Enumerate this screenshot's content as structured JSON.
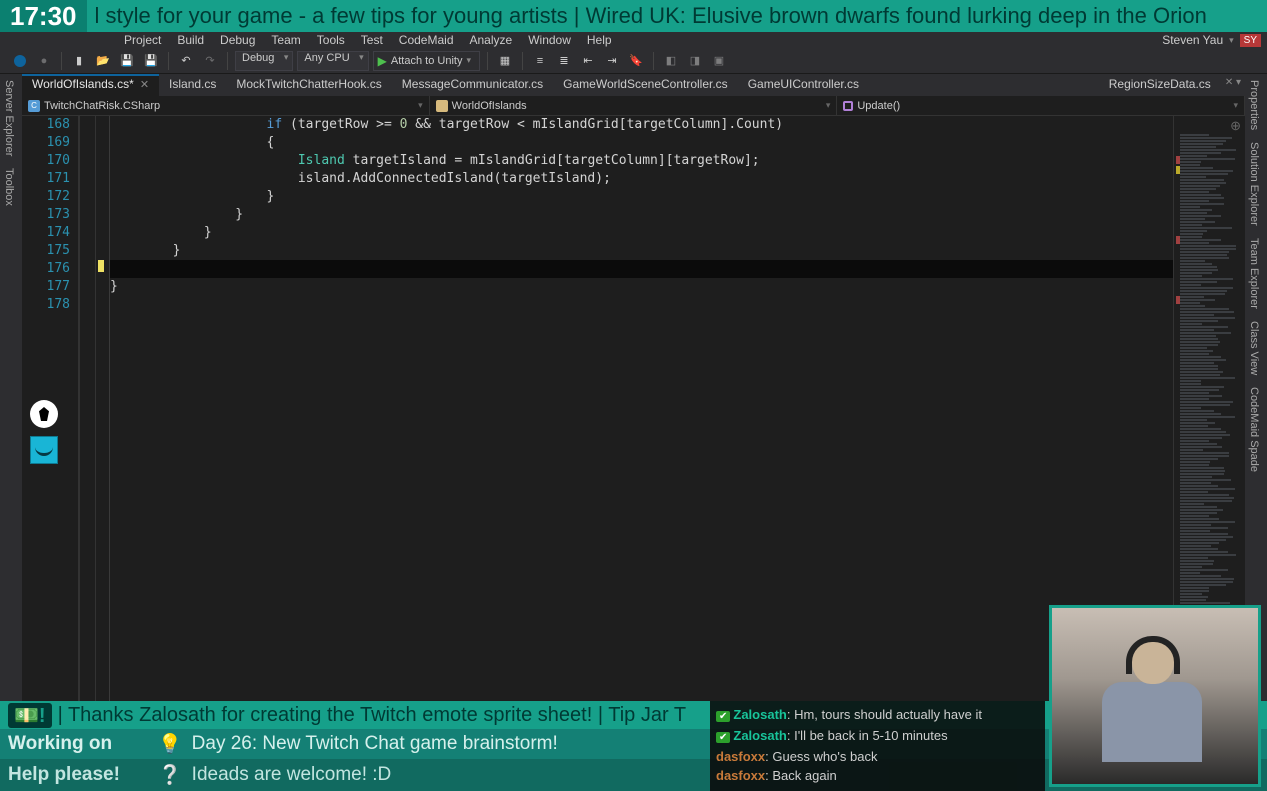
{
  "stream": {
    "time": "17:30",
    "ticker": "l style for your game - a few tips for young artists | Wired UK: Elusive brown dwarfs found lurking deep in the Orion",
    "tip_icon": "💵!",
    "tip_text": " | Thanks Zalosath for creating the Twitch emote sprite sheet! | Tip Jar T",
    "working_label": "Working on",
    "working_text": "Day 26: New Twitch Chat game brainstorm!",
    "help_label": "Help please!",
    "help_text": "Ideads are welcome! :D"
  },
  "menu": {
    "items": [
      "Project",
      "Build",
      "Debug",
      "Team",
      "Tools",
      "Test",
      "CodeMaid",
      "Analyze",
      "Window",
      "Help"
    ],
    "user": "Steven Yau",
    "user_initials": "SY"
  },
  "toolbar": {
    "config": "Debug",
    "platform": "Any CPU",
    "attach": "Attach to Unity"
  },
  "leftPanels": [
    "Server Explorer",
    "Toolbox"
  ],
  "rightPanels": [
    "Properties",
    "Solution Explorer",
    "Team Explorer",
    "Class View",
    "CodeMaid Spade"
  ],
  "tabs": [
    {
      "label": "WorldOfIslands.cs*",
      "active": true,
      "closeable": true
    },
    {
      "label": "Island.cs"
    },
    {
      "label": "MockTwitchChatterHook.cs"
    },
    {
      "label": "MessageCommunicator.cs"
    },
    {
      "label": "GameWorldSceneController.cs"
    },
    {
      "label": "GameUIController.cs"
    }
  ],
  "tabsRight": [
    {
      "label": "RegionSizeData.cs"
    }
  ],
  "nav": {
    "project": "TwitchChatRisk.CSharp",
    "class": "WorldOfIslands",
    "member": "Update()"
  },
  "code": {
    "startLine": 168,
    "activeRow": 8,
    "lines": [
      {
        "indent": 20,
        "seg": [
          {
            "t": "if ",
            "c": "kw"
          },
          {
            "t": "(targetRow >= "
          },
          {
            "t": "0",
            "c": "num"
          },
          {
            "t": " && targetRow < mIslandGrid[targetColumn].Count)"
          }
        ]
      },
      {
        "indent": 20,
        "seg": [
          {
            "t": "{"
          }
        ]
      },
      {
        "indent": 24,
        "seg": [
          {
            "t": "Island",
            "c": "type"
          },
          {
            "t": " targetIsland = mIslandGrid[targetColumn][targetRow];"
          }
        ]
      },
      {
        "indent": 24,
        "seg": [
          {
            "t": "island.AddConnectedIsland(targetIsland);"
          }
        ]
      },
      {
        "indent": 20,
        "seg": [
          {
            "t": "}"
          }
        ]
      },
      {
        "indent": 16,
        "seg": [
          {
            "t": "}"
          }
        ]
      },
      {
        "indent": 12,
        "seg": [
          {
            "t": "}"
          }
        ]
      },
      {
        "indent": 8,
        "seg": [
          {
            "t": "}"
          }
        ]
      },
      {
        "indent": 4,
        "seg": [
          {
            "t": ""
          }
        ]
      },
      {
        "indent": 0,
        "seg": [
          {
            "t": "}"
          }
        ]
      },
      {
        "indent": 0,
        "seg": [
          {
            "t": ""
          }
        ]
      }
    ]
  },
  "chat": [
    {
      "mod": true,
      "user": "Zalosath",
      "ustyle": "chat-user1",
      "msg": "Hm, tours should actually have it"
    },
    {
      "mod": true,
      "user": "Zalosath",
      "ustyle": "chat-user1",
      "msg": "I'll be back in 5-10 minutes"
    },
    {
      "mod": false,
      "user": "dasfoxx",
      "ustyle": "chat-user2",
      "msg": "Guess who's back"
    },
    {
      "mod": false,
      "user": "dasfoxx",
      "ustyle": "chat-user2",
      "msg": "Back again"
    }
  ]
}
